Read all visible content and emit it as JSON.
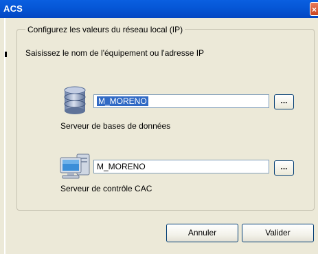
{
  "window": {
    "title": "ACS",
    "close_glyph": "×"
  },
  "group": {
    "legend": "Configurez les valeurs du réseau local (IP)"
  },
  "instruction": "Saisissez le nom de l'équipement ou l'adresse IP",
  "database": {
    "value": "M_MORENO",
    "label": "Serveur de bases de données",
    "browse_label": "...",
    "icon": "database-icon"
  },
  "cac": {
    "value": "M_MORENO",
    "label": "Serveur de contrôle CAC",
    "browse_label": "...",
    "icon": "computer-icon"
  },
  "buttons": {
    "cancel": "Annuler",
    "ok": "Valider"
  },
  "colors": {
    "titlebar": "#0556d6",
    "dialog_bg": "#ece9d8",
    "selection": "#316ac5"
  }
}
